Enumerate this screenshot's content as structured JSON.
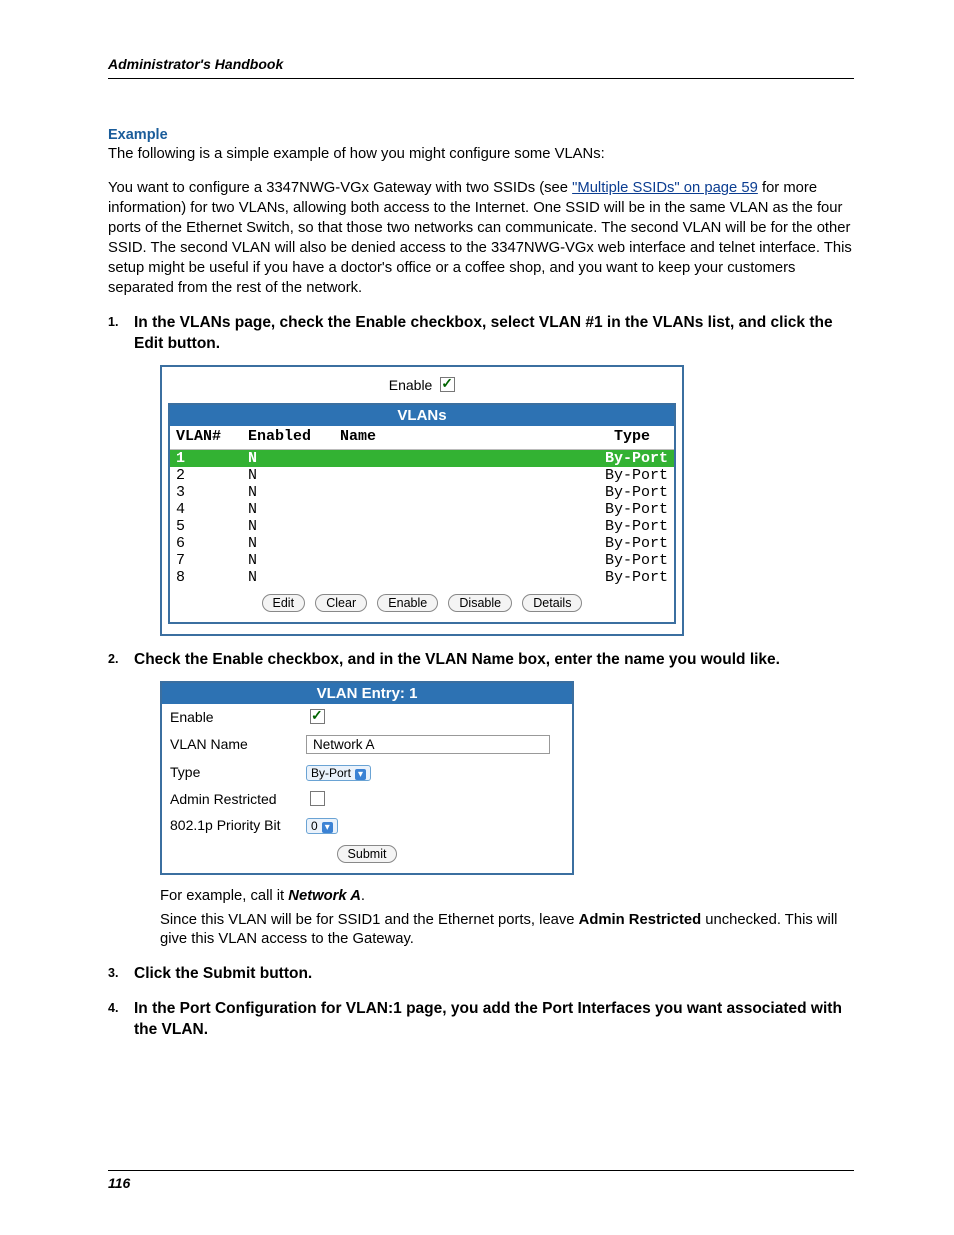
{
  "header": {
    "running": "Administrator's Handbook"
  },
  "example": {
    "label": "Example",
    "intro": "The following is a simple example of how you might configure some VLANs:",
    "p2_a": "You want to configure a 3347NWG-VGx Gateway with two SSIDs (see ",
    "link": "\"Multiple SSIDs\" on page 59",
    "p2_b": " for more information) for two VLANs, allowing both access to the Internet. One SSID will be in the same VLAN as the four ports of the Ethernet Switch, so that those two networks can communicate. The second VLAN will be for the other SSID. The second VLAN will also be denied access to the 3347NWG-VGx web interface and telnet interface. This setup might be useful if you have a doctor's office or a coffee shop, and you want to keep your customers separated from the rest of the network."
  },
  "steps": {
    "s1": {
      "num": "1.",
      "text": "In the VLANs page, check the Enable checkbox, select VLAN #1 in the VLANs list, and click the Edit button."
    },
    "s2": {
      "num": "2.",
      "text": "Check the Enable checkbox, and in the VLAN Name box, enter the name you would like."
    },
    "s3": {
      "num": "3.",
      "text": "Click the Submit button."
    },
    "s4": {
      "num": "4.",
      "text": "In the Port Configuration for VLAN:1 page, you add the Port Interfaces you want associated with the VLAN."
    }
  },
  "fig1": {
    "enable_label": "Enable",
    "title": "VLANs",
    "cols": {
      "vlan": "VLAN#",
      "enabled": "Enabled",
      "name": "Name",
      "type": "Type"
    },
    "rows": [
      {
        "n": "1",
        "en": "N",
        "type": "By-Port",
        "sel": true
      },
      {
        "n": "2",
        "en": "N",
        "type": "By-Port"
      },
      {
        "n": "3",
        "en": "N",
        "type": "By-Port"
      },
      {
        "n": "4",
        "en": "N",
        "type": "By-Port"
      },
      {
        "n": "5",
        "en": "N",
        "type": "By-Port"
      },
      {
        "n": "6",
        "en": "N",
        "type": "By-Port"
      },
      {
        "n": "7",
        "en": "N",
        "type": "By-Port"
      },
      {
        "n": "8",
        "en": "N",
        "type": "By-Port"
      }
    ],
    "buttons": {
      "edit": "Edit",
      "clear": "Clear",
      "enable": "Enable",
      "disable": "Disable",
      "details": "Details"
    }
  },
  "fig2": {
    "title": "VLAN Entry: 1",
    "rows": {
      "enable": "Enable",
      "name_lab": "VLAN Name",
      "name_val": "Network A",
      "type_lab": "Type",
      "type_val": "By-Port",
      "admin": "Admin Restricted",
      "prio_lab": "802.1p Priority Bit",
      "prio_val": "0"
    },
    "submit": "Submit"
  },
  "after": {
    "l1a": "For example, call it ",
    "l1b": "Network A",
    "l1c": ".",
    "l2a": "Since this VLAN will be for SSID1 and the Ethernet ports, leave ",
    "l2b": "Admin Restricted",
    "l2c": " unchecked. This will give this VLAN access to the Gateway."
  },
  "footer": {
    "page": "116"
  }
}
